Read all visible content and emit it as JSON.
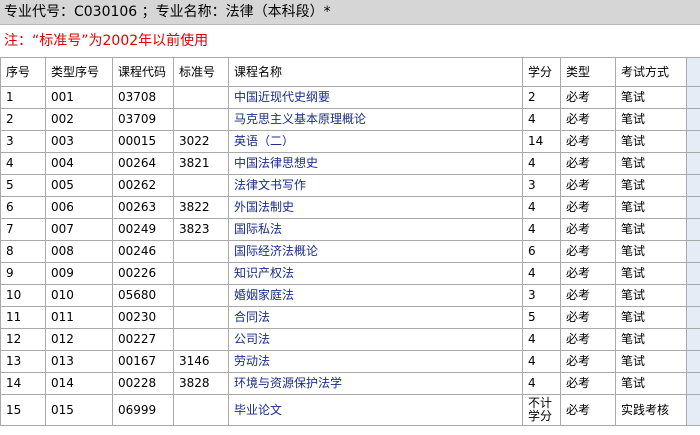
{
  "header": {
    "text": "专业代号：C030106 ；专业名称：法律（本科段）*"
  },
  "note": {
    "text": "注：“标准号”为2002年以前使用"
  },
  "table": {
    "columns": [
      "序号",
      "类型序号",
      "课程代码",
      "标准号",
      "课程名称",
      "学分",
      "类型",
      "考试方式"
    ],
    "rows": [
      [
        "1",
        "001",
        "03708",
        "",
        "中国近现代史纲要",
        "2",
        "必考",
        "笔试"
      ],
      [
        "2",
        "002",
        "03709",
        "",
        "马克思主义基本原理概论",
        "4",
        "必考",
        "笔试"
      ],
      [
        "3",
        "003",
        "00015",
        "3022",
        "英语（二）",
        "14",
        "必考",
        "笔试"
      ],
      [
        "4",
        "004",
        "00264",
        "3821",
        "中国法律思想史",
        "4",
        "必考",
        "笔试"
      ],
      [
        "5",
        "005",
        "00262",
        "",
        "法律文书写作",
        "3",
        "必考",
        "笔试"
      ],
      [
        "6",
        "006",
        "00263",
        "3822",
        "外国法制史",
        "4",
        "必考",
        "笔试"
      ],
      [
        "7",
        "007",
        "00249",
        "3823",
        "国际私法",
        "4",
        "必考",
        "笔试"
      ],
      [
        "8",
        "008",
        "00246",
        "",
        "国际经济法概论",
        "6",
        "必考",
        "笔试"
      ],
      [
        "9",
        "009",
        "00226",
        "",
        "知识产权法",
        "4",
        "必考",
        "笔试"
      ],
      [
        "10",
        "010",
        "05680",
        "",
        "婚姻家庭法",
        "3",
        "必考",
        "笔试"
      ],
      [
        "11",
        "011",
        "00230",
        "",
        "合同法",
        "5",
        "必考",
        "笔试"
      ],
      [
        "12",
        "012",
        "00227",
        "",
        "公司法",
        "4",
        "必考",
        "笔试"
      ],
      [
        "13",
        "013",
        "00167",
        "3146",
        "劳动法",
        "4",
        "必考",
        "笔试"
      ],
      [
        "14",
        "014",
        "00228",
        "3828",
        "环境与资源保护法学",
        "4",
        "必考",
        "笔试"
      ],
      [
        "15",
        "015",
        "06999",
        "",
        "毕业论文",
        "不计学分",
        "必考",
        "实践考核"
      ]
    ]
  }
}
